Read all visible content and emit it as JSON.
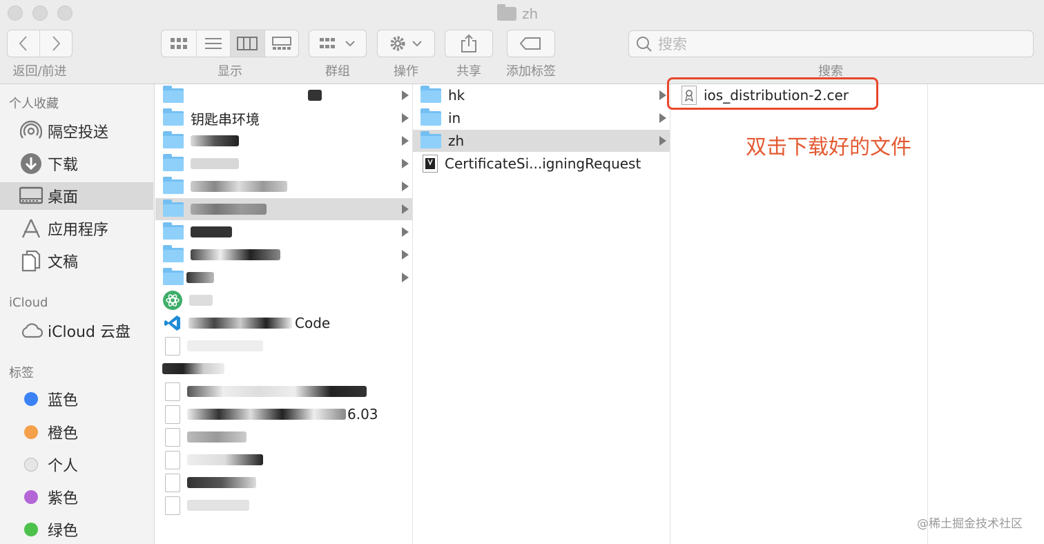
{
  "window": {
    "title": "zh"
  },
  "toolbar": {
    "nav_label": "返回/前进",
    "view_label": "显示",
    "group_label": "群组",
    "action_label": "操作",
    "share_label": "共享",
    "tags_label": "添加标签",
    "search_label": "搜索",
    "search_placeholder": "搜索"
  },
  "sidebar": {
    "favorites_header": "个人收藏",
    "favorites": [
      {
        "label": "隔空投送",
        "icon": "airdrop-icon"
      },
      {
        "label": "下载",
        "icon": "download-icon"
      },
      {
        "label": "桌面",
        "icon": "desktop-icon",
        "selected": true
      },
      {
        "label": "应用程序",
        "icon": "applications-icon"
      },
      {
        "label": "文稿",
        "icon": "documents-icon"
      }
    ],
    "icloud_header": "iCloud",
    "icloud": [
      {
        "label": "iCloud 云盘",
        "icon": "cloud-icon"
      }
    ],
    "tags_header": "标签",
    "tags": [
      {
        "label": "蓝色",
        "color": "#3b82f6"
      },
      {
        "label": "橙色",
        "color": "#f5a04a"
      },
      {
        "label": "个人",
        "color": "#e6e6e6"
      },
      {
        "label": "紫色",
        "color": "#b466d6"
      },
      {
        "label": "绿色",
        "color": "#4cc24c"
      }
    ]
  },
  "column1": {
    "visible_names": {
      "keychain_env": "钥匙串环境",
      "file_ending": "6.03",
      "code_suffix": "Code"
    }
  },
  "column2": {
    "items": [
      {
        "name": "hk",
        "type": "folder"
      },
      {
        "name": "in",
        "type": "folder"
      },
      {
        "name": "zh",
        "type": "folder",
        "selected": true
      },
      {
        "name": "CertificateSi...igningRequest",
        "type": "file"
      }
    ]
  },
  "column3": {
    "items": [
      {
        "name": "ios_distribution-2.cer",
        "type": "certificate"
      }
    ]
  },
  "annotation": {
    "text": "双击下载好的文件",
    "color": "#e35a32"
  },
  "watermark": "@稀土掘金技术社区"
}
